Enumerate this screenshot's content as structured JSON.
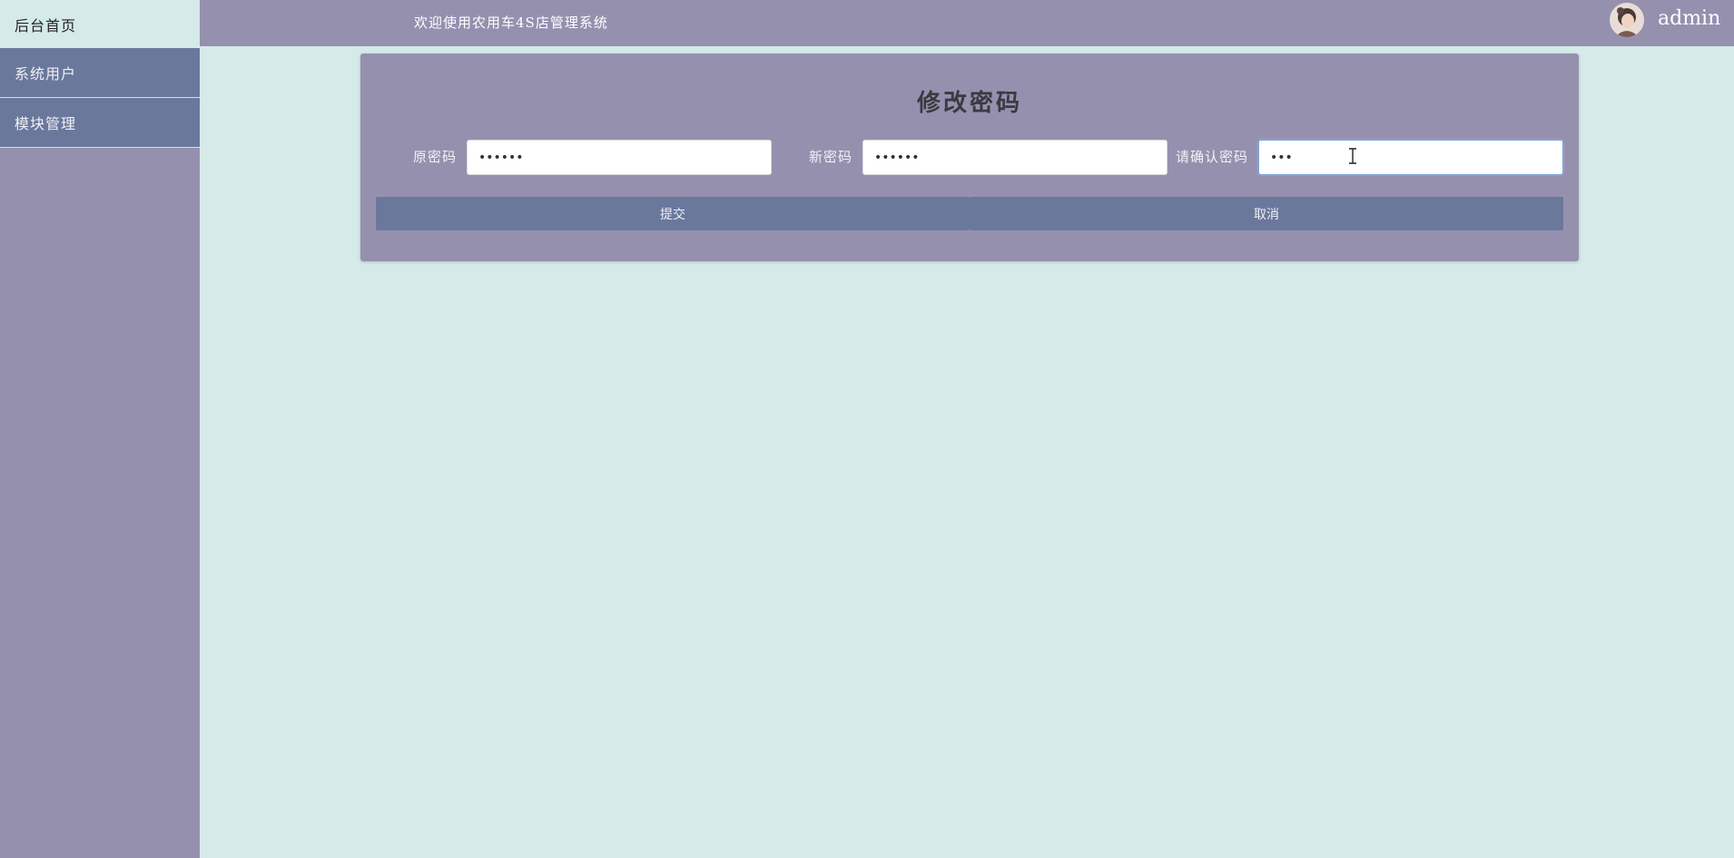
{
  "sidebar": {
    "home_label": "后台首页",
    "items": [
      {
        "label": "系统用户"
      },
      {
        "label": "模块管理"
      }
    ]
  },
  "header": {
    "title": "欢迎使用农用车4S店管理系统",
    "username": "admin"
  },
  "form": {
    "title": "修改密码",
    "old_password": {
      "label": "原密码",
      "value": "••••••"
    },
    "new_password": {
      "label": "新密码",
      "value": "••••••"
    },
    "confirm_password": {
      "label": "请确认密码",
      "value": "•••"
    },
    "submit_label": "提交",
    "cancel_label": "取消"
  },
  "colors": {
    "page_bg": "#d5eae9",
    "sidebar_bg": "#9690af",
    "header_bg": "#9690af",
    "nav_item_bg": "#6a789c",
    "panel_bg": "#9690af",
    "button_bg": "#6a789c"
  }
}
